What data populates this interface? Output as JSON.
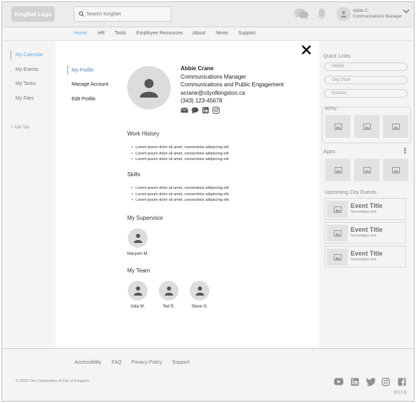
{
  "header": {
    "logo": "KingNet Logo",
    "search_placeholder": "Search KingNet",
    "user": {
      "name": "Abbie C.",
      "role": "Communications Manager"
    }
  },
  "nav": [
    "Home",
    "HR",
    "Tools",
    "Employee Resources",
    "About",
    "News",
    "Support"
  ],
  "sidebar": {
    "items": [
      "My Calendar",
      "My Events",
      "My Tasks",
      "My Files"
    ],
    "add_tab": "+ Add Tab"
  },
  "profile_modal": {
    "menu": [
      "My Profile",
      "Manage Account",
      "Edit Profile"
    ],
    "name": "Abbie Crane",
    "title": "Communications Manager",
    "department": "Communications and Public Engagement",
    "email": "acrane@cityofkingston.ca",
    "phone": "(343) 123-45678",
    "social_icons": [
      "mail-icon",
      "chat-icon",
      "linkedin-icon",
      "instagram-icon"
    ],
    "work_history": {
      "heading": "Work History",
      "items": [
        "Lorem ipsum dolor sit amet, consectetur adipiscing elit",
        "Lorem ipsum dolor sit amet, consectetur adipiscing elit",
        "Lorem ipsum dolor sit amet, consectetur adipiscing elit"
      ]
    },
    "skills": {
      "heading": "Skills",
      "items": [
        "Lorem ipsum dolor sit amet, consectetur adipiscing elit",
        "Lorem ipsum dolor sit amet, consectetur adipiscing elit",
        "Lorem ipsum dolor sit amet, consectetur adipiscing elit"
      ]
    },
    "supervisor": {
      "heading": "My Supervisor",
      "name": "Maryam M."
    },
    "team": {
      "heading": "My Team",
      "members": [
        "Julia M.",
        "Ted R.",
        "Steve G."
      ]
    }
  },
  "right_panel": {
    "quick_links": {
      "heading": "Quick Links",
      "links": [
        "HRMS",
        "Org Chart",
        "Policies"
      ]
    },
    "kpis_heading": "KPIs",
    "apps_heading": "Apps",
    "events": {
      "heading": "Upcoming City Events",
      "items": [
        {
          "title": "Event Title",
          "subtitle": "Secondary text"
        },
        {
          "title": "Event Title",
          "subtitle": "Secondary text"
        },
        {
          "title": "Event Title",
          "subtitle": "Secondary text"
        }
      ]
    }
  },
  "footer": {
    "links": [
      "Accessibility",
      "FAQ",
      "Privacy Policy",
      "Support"
    ],
    "copyright": "© 2023 The Corporation of City of Kingston",
    "social_icons": [
      "youtube-icon",
      "linkedin-icon",
      "twitter-icon",
      "instagram-icon",
      "facebook-icon"
    ],
    "watermark": "miro"
  },
  "colors": {
    "accent": "#6aa9df",
    "muted_text": "#777777",
    "placeholder": "#dcdcdc"
  }
}
